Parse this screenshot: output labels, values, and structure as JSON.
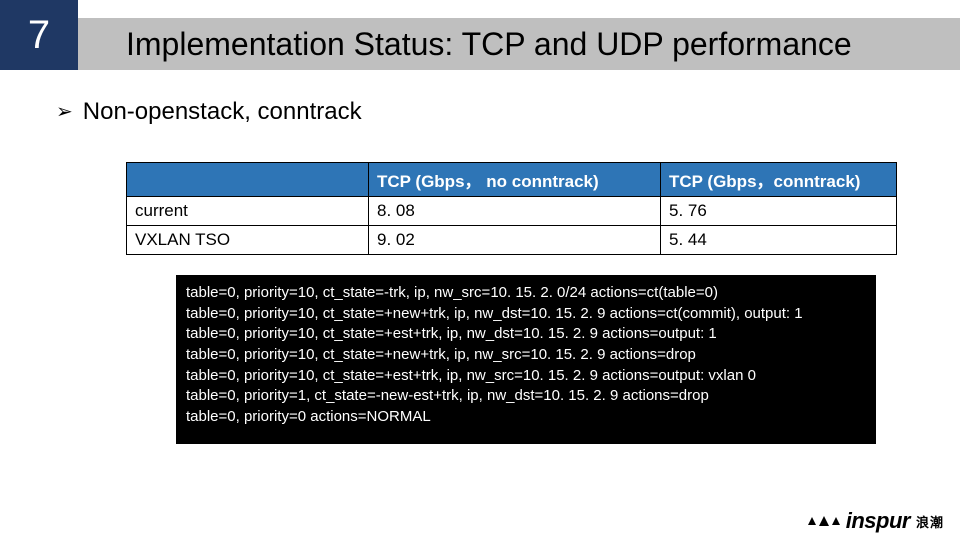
{
  "header": {
    "slide_number": "7",
    "title": "Implementation Status: TCP and UDP performance"
  },
  "bullet": {
    "text": "Non-openstack, conntrack"
  },
  "table": {
    "headers": [
      "",
      "TCP (Gbps， no conntrack)",
      "TCP (Gbps，conntrack)"
    ],
    "rows": [
      {
        "label": "current",
        "no_conntrack": "8. 08",
        "conntrack": "5. 76"
      },
      {
        "label": "VXLAN TSO",
        "no_conntrack": "9. 02",
        "conntrack": "5. 44"
      }
    ]
  },
  "code": {
    "lines": [
      "table=0, priority=10, ct_state=-trk, ip, nw_src=10. 15. 2. 0/24 actions=ct(table=0)",
      "table=0, priority=10, ct_state=+new+trk, ip, nw_dst=10. 15. 2. 9 actions=ct(commit), output: 1",
      "table=0, priority=10, ct_state=+est+trk, ip, nw_dst=10. 15. 2. 9 actions=output: 1",
      "table=0, priority=10, ct_state=+new+trk, ip, nw_src=10. 15. 2. 9 actions=drop",
      "table=0, priority=10, ct_state=+est+trk, ip, nw_src=10. 15. 2. 9 actions=output: vxlan 0",
      "table=0, priority=1, ct_state=-new-est+trk, ip, nw_dst=10. 15. 2. 9 actions=drop",
      "table=0, priority=0 actions=NORMAL"
    ]
  },
  "logo": {
    "text": "inspur",
    "cjk": "浪潮"
  }
}
